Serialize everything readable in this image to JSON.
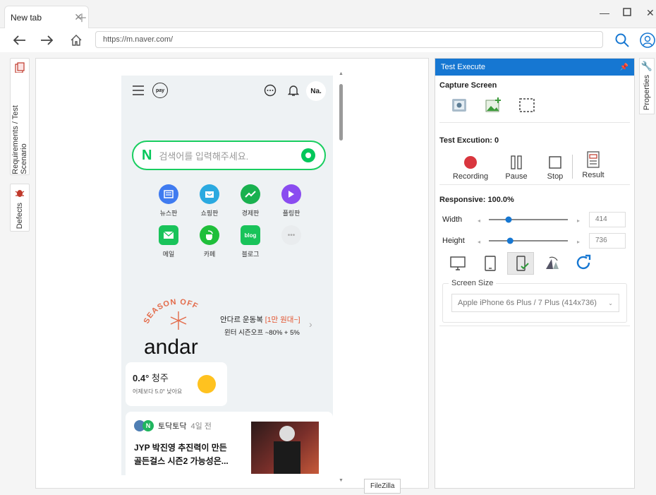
{
  "browser": {
    "tab_title": "New tab",
    "url": "https://m.naver.com/"
  },
  "left_rail": {
    "requirements_label": "Requirements / Test Scenario",
    "defects_label": "Defects"
  },
  "right_rail": {
    "properties_label": "Properties"
  },
  "mobile": {
    "header_right_text": "Na.",
    "pay_label": "pay",
    "search_logo": "N",
    "search_placeholder": "검색어를 입력해주세요.",
    "services": [
      {
        "label": "뉴스판",
        "icon": "news-icon",
        "color": "#3f7bf0"
      },
      {
        "label": "쇼핑판",
        "icon": "shopping-icon",
        "color": "#2aa9e0"
      },
      {
        "label": "경제판",
        "icon": "economy-icon",
        "color": "#19b14f"
      },
      {
        "label": "플링판",
        "icon": "play-icon",
        "color": "#8a4cf0"
      },
      {
        "label": "메일",
        "icon": "mail-icon",
        "color": "#19c35a"
      },
      {
        "label": "카페",
        "icon": "cafe-icon",
        "color": "#1fbf3a"
      },
      {
        "label": "블로그",
        "icon": "blog-icon",
        "color": "#19c35a"
      },
      {
        "label": "",
        "icon": "more-icon",
        "color": "#e9ecee"
      }
    ],
    "blog_badge": "blog",
    "banner": {
      "arc_text": "SEASON OFF",
      "brand": "andar",
      "line1_a": "안다르 운동복 ",
      "line1_b": "[1만 원대~]",
      "line2": "윈터 시즌오프 ~80% + 5%"
    },
    "weather": {
      "temp": "0.4°",
      "city": "청주",
      "desc": "어제보다 5.0° 낮아요"
    },
    "news": {
      "source": "토닥토닥",
      "time": "4일 전",
      "title_l1": "JYP 박진영 추진력이 만든",
      "title_l2": "골든걸스 시즌2 가능성은..."
    }
  },
  "panel": {
    "title": "Test Execute",
    "capture_screen": "Capture Screen",
    "test_execution": "Test Excution: 0",
    "controls": {
      "recording": "Recording",
      "pause": "Pause",
      "stop": "Stop",
      "result": "Result"
    },
    "responsive": "Responsive: 100.0%",
    "width_label": "Width",
    "width_value": "414",
    "width_fraction": 0.25,
    "height_label": "Height",
    "height_value": "736",
    "height_fraction": 0.27,
    "screen_size_label": "Screen Size",
    "screen_size_value": "Apple iPhone 6s Plus / 7 Plus (414x736)"
  },
  "tooltip": "FileZilla",
  "colors": {
    "accent": "#1677d2",
    "naver_green": "#03c75a",
    "record_red": "#d9363e"
  }
}
